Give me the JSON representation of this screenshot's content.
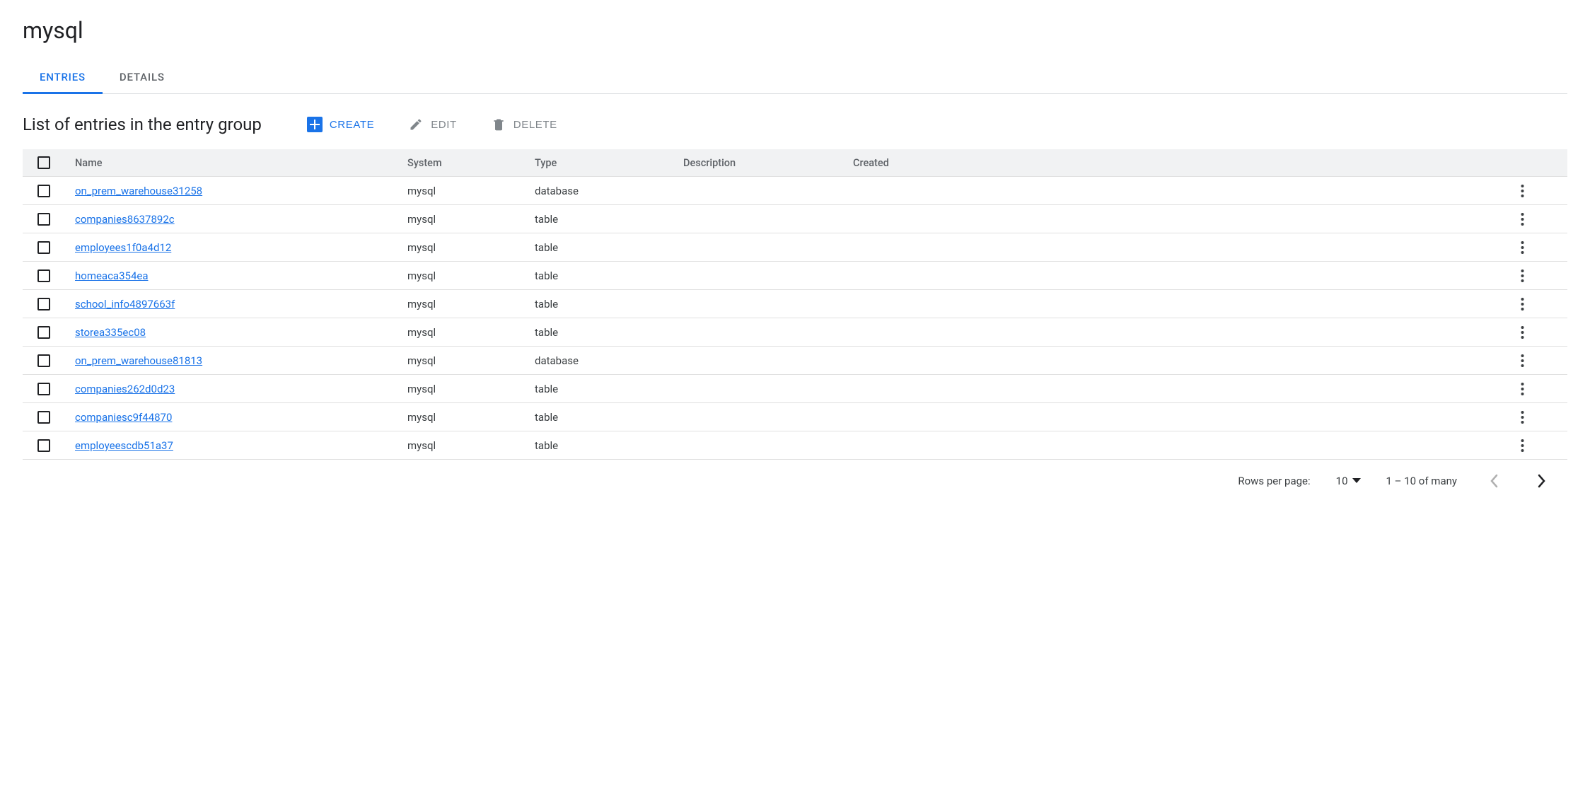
{
  "page": {
    "title": "mysql"
  },
  "tabs": [
    {
      "label": "ENTRIES",
      "active": true
    },
    {
      "label": "DETAILS",
      "active": false
    }
  ],
  "toolbar": {
    "title": "List of entries in the entry group",
    "create_label": "CREATE",
    "edit_label": "EDIT",
    "delete_label": "DELETE"
  },
  "table": {
    "headers": {
      "name": "Name",
      "system": "System",
      "type": "Type",
      "description": "Description",
      "created": "Created"
    },
    "rows": [
      {
        "name": "on_prem_warehouse31258",
        "system": "mysql",
        "type": "database",
        "description": "",
        "created": ""
      },
      {
        "name": "companies8637892c",
        "system": "mysql",
        "type": "table",
        "description": "",
        "created": ""
      },
      {
        "name": "employees1f0a4d12",
        "system": "mysql",
        "type": "table",
        "description": "",
        "created": ""
      },
      {
        "name": "homeaca354ea",
        "system": "mysql",
        "type": "table",
        "description": "",
        "created": ""
      },
      {
        "name": "school_info4897663f",
        "system": "mysql",
        "type": "table",
        "description": "",
        "created": ""
      },
      {
        "name": "storea335ec08",
        "system": "mysql",
        "type": "table",
        "description": "",
        "created": ""
      },
      {
        "name": "on_prem_warehouse81813",
        "system": "mysql",
        "type": "database",
        "description": "",
        "created": ""
      },
      {
        "name": "companies262d0d23",
        "system": "mysql",
        "type": "table",
        "description": "",
        "created": ""
      },
      {
        "name": "companiesc9f44870",
        "system": "mysql",
        "type": "table",
        "description": "",
        "created": ""
      },
      {
        "name": "employeescdb51a37",
        "system": "mysql",
        "type": "table",
        "description": "",
        "created": ""
      }
    ]
  },
  "pagination": {
    "rows_label": "Rows per page:",
    "rows_value": "10",
    "range_label": "1 – 10 of many"
  }
}
